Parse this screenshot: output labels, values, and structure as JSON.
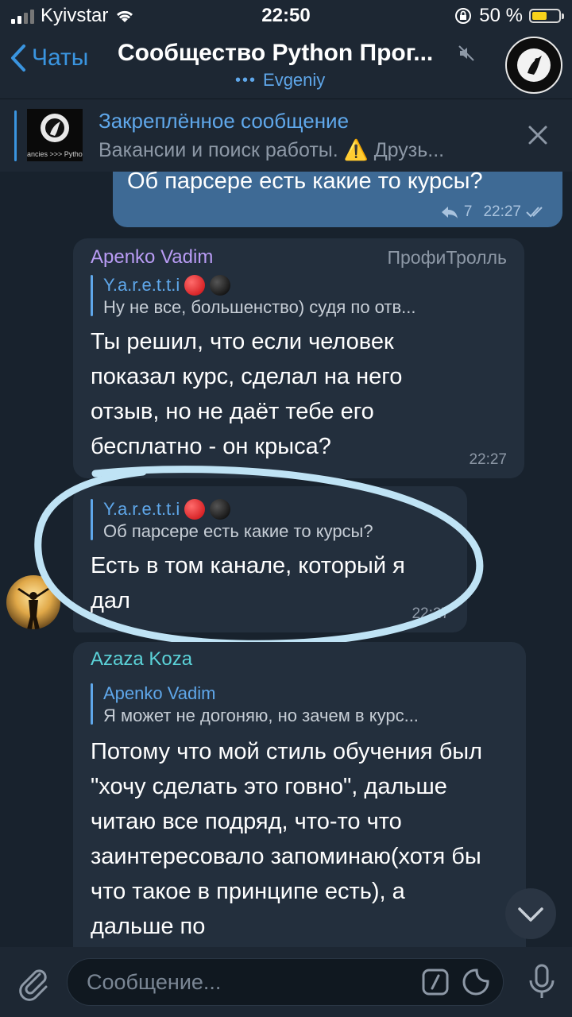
{
  "status_bar": {
    "carrier": "Kyivstar",
    "time": "22:50",
    "battery": "50 %",
    "battery_level": 0.5
  },
  "header": {
    "back_label": "Чаты",
    "title": "Сообщество Python Прог...",
    "typing_user": "Evgeniy"
  },
  "pinned": {
    "title": "Закреплённое сообщение",
    "text": "Вакансии и поиск работы. ⚠️ Друзь...",
    "thumb_caption": "ancies >>> Pythor"
  },
  "messages": [
    {
      "text": "Об парсере есть какие то курсы?",
      "views": "7",
      "time": "22:27"
    },
    {
      "sender": "Apenko Vadim",
      "sender_title": "ПрофиТролль",
      "reply_name": "Y.a.r.e.t.t.i",
      "reply_text": "Ну не все, большенство)  судя по отв...",
      "text": "Ты решил, что если человек показал курс, сделал на него отзыв, но не даёт тебе его бесплатно - он крыса?",
      "time": "22:27"
    },
    {
      "reply_name": "Y.a.r.e.t.t.i",
      "reply_text": "Об парсере есть какие то курсы?",
      "text": "Есть в том канале, который я дал",
      "time": "22:27"
    },
    {
      "sender": "Azaza Koza",
      "reply_name": "Apenko Vadim",
      "reply_text": "Я может не догоняю, но зачем в курс...",
      "text": "Потому что мой стиль обучения был \"хочу сделать это говно\", дальше читаю все подряд, что-то что заинтересовало запоминаю(хотя бы что такое в принципе есть), а дальше по"
    }
  ],
  "input": {
    "placeholder": "Сообщение..."
  },
  "colors": {
    "background": "#18222d",
    "bar": "#1d2733",
    "accent": "#3a95e0",
    "outgoing_bubble": "#3e6a95",
    "incoming_bubble": "#232f3d",
    "sender_purple": "#b99cf5",
    "sender_cyan": "#5bd2d8",
    "annotation": "#bfe3f5"
  }
}
